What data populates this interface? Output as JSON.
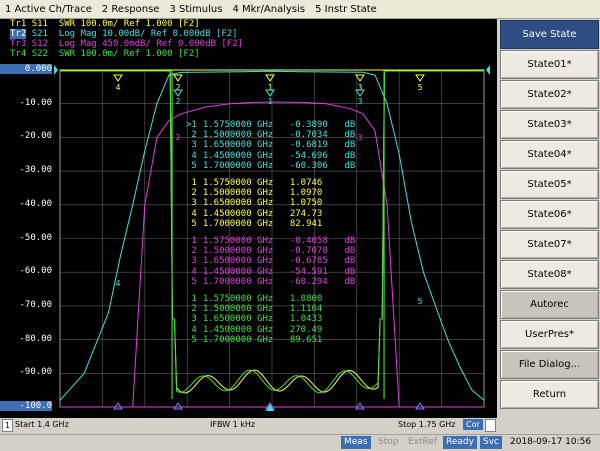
{
  "menu": {
    "items": [
      "1 Active Ch/Trace",
      "2 Response",
      "3 Stimulus",
      "4 Mkr/Analysis",
      "5 Instr State"
    ]
  },
  "traces": [
    {
      "label": "Tr1",
      "text": "S11  SWR 100.0m/ Ref 1.000 [F2]",
      "color": "#ffff40"
    },
    {
      "label": "Tr2",
      "text": "S21  Log Mag 10.00dB/ Ref 0.000dB [F2]",
      "color": "#40e0e0",
      "active": true
    },
    {
      "label": "Tr3",
      "text": "S12  Log Mag 450.0mdB/ Ref 0.000dB [F2]",
      "color": "#e040e0"
    },
    {
      "label": "Tr4",
      "text": "S22  SWR 100.0m/ Ref 1.000 [F2]",
      "color": "#40e040"
    }
  ],
  "y_axis": {
    "labels": [
      "0.000",
      "-10.00",
      "-20.00",
      "-30.00",
      "-40.00",
      "-50.00",
      "-60.00",
      "-70.00",
      "-80.00",
      "-90.00",
      "-100.0"
    ],
    "highlight": [
      0,
      10
    ]
  },
  "marker_tables": [
    {
      "color": "#40e0e0",
      "rows": [
        {
          "id": ">1",
          "freq": "1.5750000 GHz",
          "value": "-0.3890",
          "unit": "dB"
        },
        {
          "id": " 2",
          "freq": "1.5000000 GHz",
          "value": "-0.7034",
          "unit": "dB"
        },
        {
          "id": " 3",
          "freq": "1.6500000 GHz",
          "value": "-0.6819",
          "unit": "dB"
        },
        {
          "id": " 4",
          "freq": "1.4500000 GHz",
          "value": "-54.696",
          "unit": "dB"
        },
        {
          "id": " 5",
          "freq": "1.7000000 GHz",
          "value": "-60.306",
          "unit": "dB"
        }
      ]
    },
    {
      "color": "#ffff40",
      "rows": [
        {
          "id": " 1",
          "freq": "1.5750000 GHz",
          "value": "1.0746",
          "unit": ""
        },
        {
          "id": " 2",
          "freq": "1.5000000 GHz",
          "value": "1.0970",
          "unit": ""
        },
        {
          "id": " 3",
          "freq": "1.6500000 GHz",
          "value": "1.0750",
          "unit": ""
        },
        {
          "id": " 4",
          "freq": "1.4500000 GHz",
          "value": "274.73",
          "unit": ""
        },
        {
          "id": " 5",
          "freq": "1.7000000 GHz",
          "value": "82.941",
          "unit": ""
        }
      ]
    },
    {
      "color": "#e040e0",
      "rows": [
        {
          "id": " 1",
          "freq": "1.5750000 GHz",
          "value": "-0.4058",
          "unit": "dB"
        },
        {
          "id": " 2",
          "freq": "1.5000000 GHz",
          "value": "-0.7078",
          "unit": "dB"
        },
        {
          "id": " 3",
          "freq": "1.6500000 GHz",
          "value": "-0.6785",
          "unit": "dB"
        },
        {
          "id": " 4",
          "freq": "1.4500000 GHz",
          "value": "-54.591",
          "unit": "dB"
        },
        {
          "id": " 5",
          "freq": "1.7000000 GHz",
          "value": "-60.294",
          "unit": "dB"
        }
      ]
    },
    {
      "color": "#40e040",
      "rows": [
        {
          "id": " 1",
          "freq": "1.5750000 GHz",
          "value": "1.0800",
          "unit": ""
        },
        {
          "id": " 2",
          "freq": "1.5000000 GHz",
          "value": "1.1164",
          "unit": ""
        },
        {
          "id": " 3",
          "freq": "1.6500000 GHz",
          "value": "1.0433",
          "unit": ""
        },
        {
          "id": " 4",
          "freq": "1.4500000 GHz",
          "value": "270.49",
          "unit": ""
        },
        {
          "id": " 5",
          "freq": "1.7000000 GHz",
          "value": "89.651",
          "unit": ""
        }
      ]
    }
  ],
  "chart_data": {
    "type": "line",
    "x_start_ghz": 1.4,
    "x_stop_ghz": 1.75,
    "ylim": [
      -100,
      0
    ],
    "grid": true,
    "series": [
      {
        "trace": "Tr2",
        "color": "#40e0e0",
        "x_ghz": [
          1.4,
          1.42,
          1.44,
          1.45,
          1.46,
          1.47,
          1.48,
          1.49,
          1.5,
          1.55,
          1.575,
          1.6,
          1.65,
          1.66,
          1.67,
          1.68,
          1.69,
          1.7,
          1.71,
          1.72,
          1.73,
          1.74,
          1.75
        ],
        "y_db": [
          -98,
          -90,
          -72,
          -55,
          -40,
          -24,
          -10,
          -1.5,
          -0.7,
          -0.5,
          -0.39,
          -0.5,
          -0.68,
          -1.5,
          -10,
          -25,
          -45,
          -60,
          -70,
          -80,
          -88,
          -95,
          -98
        ]
      },
      {
        "trace": "Tr3",
        "color": "#e040e0",
        "x_ghz": [
          1.46,
          1.47,
          1.48,
          1.49,
          1.5,
          1.52,
          1.54,
          1.56,
          1.575,
          1.6,
          1.62,
          1.64,
          1.65,
          1.66,
          1.67,
          1.68,
          1.69
        ],
        "y_db": [
          -100,
          -40,
          -20,
          -15,
          -13,
          -11,
          -10,
          -9.6,
          -9.5,
          -9.6,
          -10,
          -11.5,
          -13,
          -18,
          -40,
          -100,
          -100
        ]
      }
    ]
  },
  "x_axis": {
    "channel": "1",
    "start": "Start 1.4 GHz",
    "ifbw": "IFBW 1 kHz",
    "stop": "Stop 1.75 GHz",
    "cor": "Cor"
  },
  "status": {
    "meas": "Meas",
    "stop": "Stop",
    "extref": "ExtRef",
    "ready": "Ready",
    "svc": "Svc",
    "datetime": "2018-09-17 10:56"
  },
  "softkeys": [
    {
      "label": "Save State",
      "style": "title"
    },
    {
      "label": "State01*"
    },
    {
      "label": "State02*"
    },
    {
      "label": "State03*"
    },
    {
      "label": "State04*"
    },
    {
      "label": "State05*"
    },
    {
      "label": "State06*"
    },
    {
      "label": "State07*"
    },
    {
      "label": "State08*"
    },
    {
      "label": "Autorec",
      "style": "dark"
    },
    {
      "label": "UserPres*"
    },
    {
      "label": "File Dialog...",
      "style": "dark"
    },
    {
      "label": "Return"
    }
  ]
}
